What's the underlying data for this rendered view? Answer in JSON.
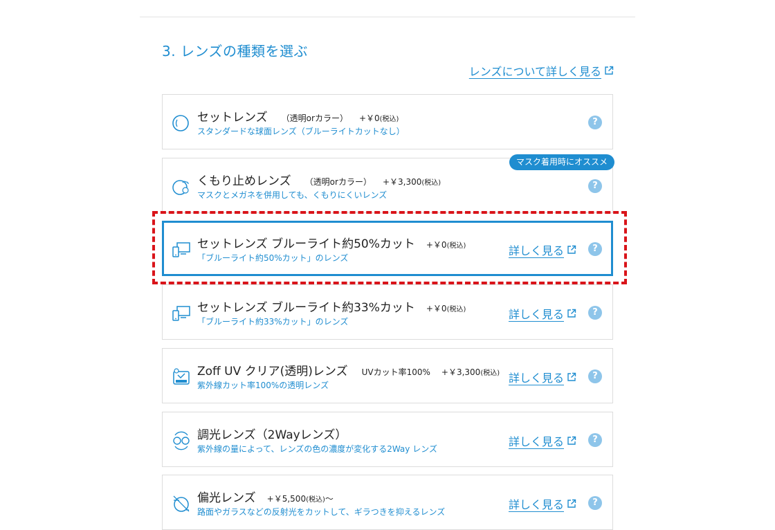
{
  "section": {
    "title": "3. レンズの種類を選ぶ",
    "more_link": "レンズについて詳しく見る"
  },
  "recommend_badge": "マスク着用時にオススメ",
  "detail_link_label": "詳しく見る",
  "help_label": "?",
  "lenses": [
    {
      "name": "セットレンズ",
      "variant": "（透明orカラー）",
      "price": "+￥0",
      "tax": "(税込)",
      "suffix": "",
      "desc": "スタンダードな球面レンズ（ブルーライトカットなし）",
      "icon": "lens-circle-icon",
      "has_detail_link": false
    },
    {
      "name": "くもり止めレンズ",
      "variant": "（透明orカラー）",
      "price": "+￥3,300",
      "tax": "(税込)",
      "suffix": "",
      "desc": "マスクとメガネを併用しても、くもりにくいレンズ",
      "icon": "anti-fog-icon",
      "has_detail_link": false
    },
    {
      "name": "セットレンズ ブルーライト約50%カット",
      "variant": "",
      "price": "+￥0",
      "tax": "(税込)",
      "suffix": "",
      "desc": "「ブルーライト約50%カット」のレンズ",
      "icon": "devices-icon",
      "has_detail_link": true,
      "selected": true
    },
    {
      "name": "セットレンズ ブルーライト約33%カット",
      "variant": "",
      "price": "+￥0",
      "tax": "(税込)",
      "suffix": "",
      "desc": "「ブルーライト約33%カット」のレンズ",
      "icon": "devices-icon",
      "has_detail_link": true
    },
    {
      "name": "Zoff UV クリア(透明)レンズ",
      "variant": "UVカット率100%",
      "price": "+￥3,300",
      "tax": "(税込)",
      "suffix": "",
      "desc": "紫外線カット率100%の透明レンズ",
      "icon": "uv-clear-icon",
      "has_detail_link": true
    },
    {
      "name": "調光レンズ（2Wayレンズ）",
      "variant": "",
      "price": "",
      "tax": "",
      "suffix": "",
      "desc": "紫外線の量によって、レンズの色の濃度が変化する2Way レンズ",
      "icon": "photochromic-icon",
      "has_detail_link": true
    },
    {
      "name": "偏光レンズ",
      "variant": "",
      "price": "+￥5,500",
      "tax": "(税込)",
      "suffix": "〜",
      "desc": "路面やガラスなどの反射光をカットして、ギラつきを抑えるレンズ",
      "icon": "polarized-icon",
      "has_detail_link": true
    }
  ],
  "colors": {
    "accent": "#1f8dd0",
    "help": "#8ec5ea",
    "highlight": "#d9141a",
    "border": "#dcdcdc"
  }
}
